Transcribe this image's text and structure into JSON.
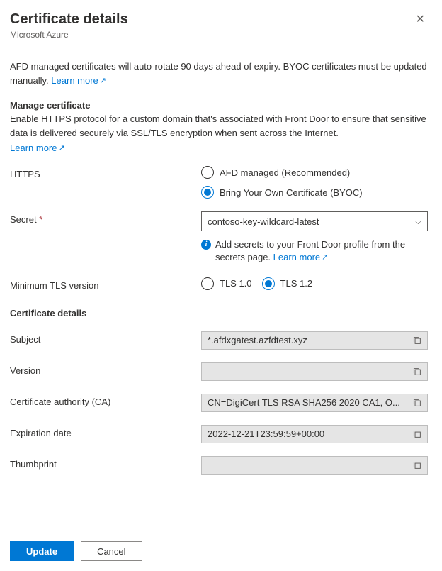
{
  "header": {
    "title": "Certificate details",
    "subtitle": "Microsoft Azure"
  },
  "intro": {
    "text": "AFD managed certificates will auto-rotate 90 days ahead of expiry. BYOC certificates must be updated manually. ",
    "learn_more": "Learn more"
  },
  "manage": {
    "heading": "Manage certificate",
    "desc": "Enable HTTPS protocol for a custom domain that's associated with Front Door to ensure that sensitive data is delivered securely via SSL/TLS encryption when sent across the Internet.",
    "learn_more": "Learn more"
  },
  "https": {
    "label": "HTTPS",
    "option_afd": "AFD managed (Recommended)",
    "option_byoc": "Bring Your Own Certificate (BYOC)"
  },
  "secret": {
    "label": "Secret",
    "value": "contoso-key-wildcard-latest",
    "info": "Add secrets to your Front Door profile from the secrets page. ",
    "learn_more": "Learn more"
  },
  "tls": {
    "label": "Minimum TLS version",
    "option_10": "TLS 1.0",
    "option_12": "TLS 1.2"
  },
  "cert_details": {
    "heading": "Certificate details",
    "subject": {
      "label": "Subject",
      "value": "*.afdxgatest.azfdtest.xyz"
    },
    "version": {
      "label": "Version",
      "value": ""
    },
    "ca": {
      "label": "Certificate authority (CA)",
      "value": "CN=DigiCert TLS RSA SHA256 2020 CA1, O..."
    },
    "expiration": {
      "label": "Expiration date",
      "value": "2022-12-21T23:59:59+00:00"
    },
    "thumbprint": {
      "label": "Thumbprint",
      "value": ""
    }
  },
  "footer": {
    "update": "Update",
    "cancel": "Cancel"
  }
}
